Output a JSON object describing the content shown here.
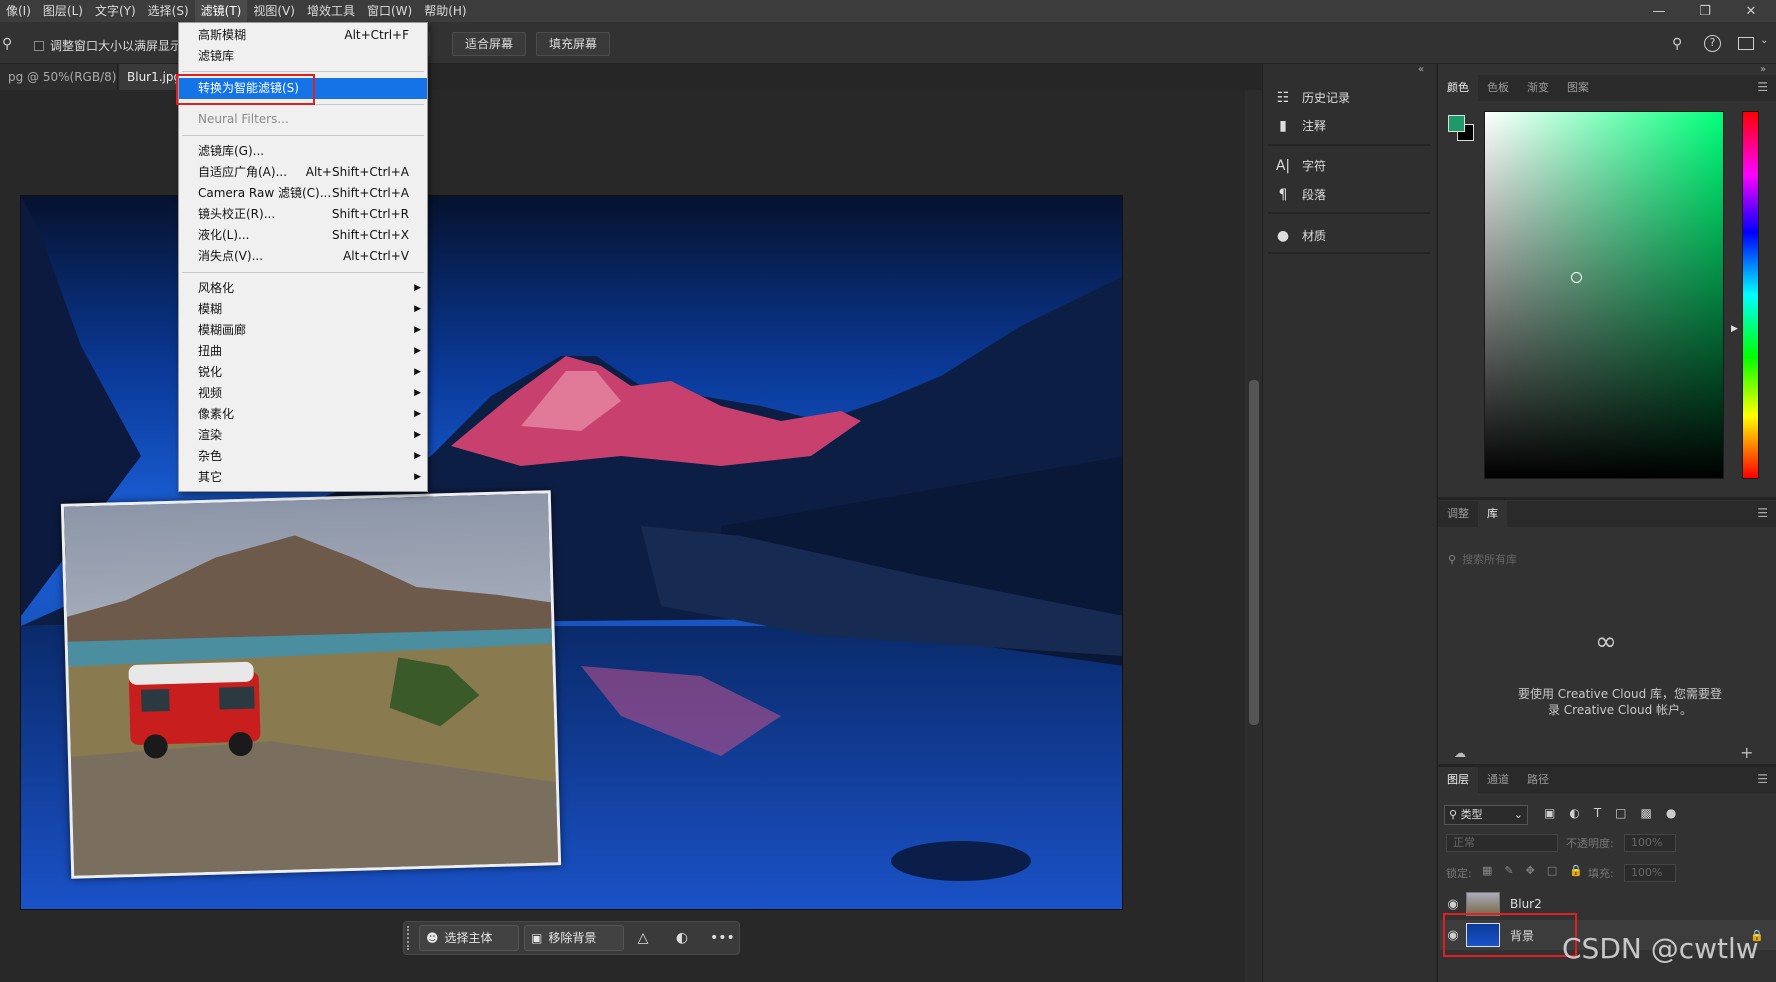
{
  "menubar": {
    "items": [
      "像(I)",
      "图层(L)",
      "文字(Y)",
      "选择(S)",
      "滤镜(T)",
      "视图(V)",
      "增效工具",
      "窗口(W)",
      "帮助(H)"
    ],
    "active_index": 4
  },
  "options": {
    "checkbox_label": "调整窗口大小以满屏显示",
    "fit_screen": "适合屏幕",
    "fill_screen": "填充屏幕"
  },
  "tabs": [
    {
      "label": "pg @ 50%(RGB/8)",
      "close": "×"
    },
    {
      "label": "Blur1.jpg"
    }
  ],
  "filter_menu": {
    "items": [
      {
        "label": "高斯模糊",
        "shortcut": "Alt+Ctrl+F"
      },
      {
        "label": "滤镜库",
        "shortcut": ""
      },
      {
        "label": "转换为智能滤镜(S)",
        "shortcut": "",
        "highlighted": true
      },
      {
        "label": "Neural Filters...",
        "shortcut": "",
        "disabled": true
      },
      {
        "label": "滤镜库(G)...",
        "shortcut": ""
      },
      {
        "label": "自适应广角(A)...",
        "shortcut": "Alt+Shift+Ctrl+A"
      },
      {
        "label": "Camera Raw 滤镜(C)...",
        "shortcut": "Shift+Ctrl+A"
      },
      {
        "label": "镜头校正(R)...",
        "shortcut": "Shift+Ctrl+R"
      },
      {
        "label": "液化(L)...",
        "shortcut": "Shift+Ctrl+X"
      },
      {
        "label": "消失点(V)...",
        "shortcut": "Alt+Ctrl+V"
      },
      {
        "label": "风格化",
        "submenu": true
      },
      {
        "label": "模糊",
        "submenu": true
      },
      {
        "label": "模糊画廊",
        "submenu": true
      },
      {
        "label": "扭曲",
        "submenu": true
      },
      {
        "label": "锐化",
        "submenu": true
      },
      {
        "label": "视频",
        "submenu": true
      },
      {
        "label": "像素化",
        "submenu": true
      },
      {
        "label": "渲染",
        "submenu": true
      },
      {
        "label": "杂色",
        "submenu": true
      },
      {
        "label": "其它",
        "submenu": true
      }
    ]
  },
  "context_toolbar": {
    "select_subject": "选择主体",
    "remove_bg": "移除背景",
    "more": "•••"
  },
  "mid_panel": {
    "items": [
      "历史记录",
      "注释",
      "字符",
      "段落",
      "材质"
    ]
  },
  "color_panel": {
    "tabs": [
      "颜色",
      "色板",
      "渐变",
      "图案"
    ],
    "foreground": "#1e9a6a",
    "background": "#000000"
  },
  "library_panel": {
    "tabs": [
      "调整",
      "库"
    ],
    "search_placeholder": "搜索所有库",
    "message_line1": "要使用 Creative Cloud 库，您需要登",
    "message_line2": "录 Creative Cloud 帐户。"
  },
  "layers_panel": {
    "tabs": [
      "图层",
      "通道",
      "路径"
    ],
    "filter_kind": "类型",
    "blend_mode": "正常",
    "opacity_label": "不透明度:",
    "opacity_value": "100%",
    "lock_label": "锁定:",
    "fill_label": "填充:",
    "fill_value": "100%",
    "layers": [
      {
        "name": "Blur2"
      },
      {
        "name": "背景"
      }
    ]
  },
  "watermark": "CSDN @cwtlw",
  "colors": {
    "accent": "#1473e6",
    "annotation_red": "#e02020"
  }
}
